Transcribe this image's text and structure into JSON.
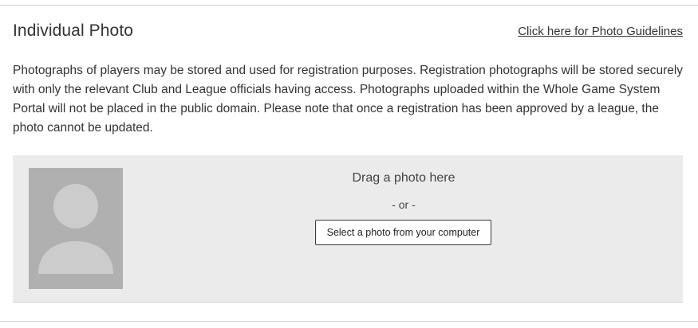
{
  "section": {
    "title": "Individual Photo",
    "guidelines_link": "Click here for Photo Guidelines",
    "description": "Photographs of players may be stored and used for registration purposes. Registration photographs will be stored securely with only the relevant Club and League officials having access. Photographs uploaded within the Whole Game System Portal will not be placed in the public domain. Please note that once a registration has been approved by a league, the photo cannot be updated."
  },
  "upload": {
    "avatar_icon": "person-silhouette-icon",
    "drag_text": "Drag a photo here",
    "or_text": "- or -",
    "select_button_label": "Select a photo from your computer"
  },
  "colors": {
    "upload_background": "#ebebeb",
    "avatar_background": "#b0b0b0",
    "avatar_silhouette": "#cccccc",
    "text": "#333333"
  }
}
